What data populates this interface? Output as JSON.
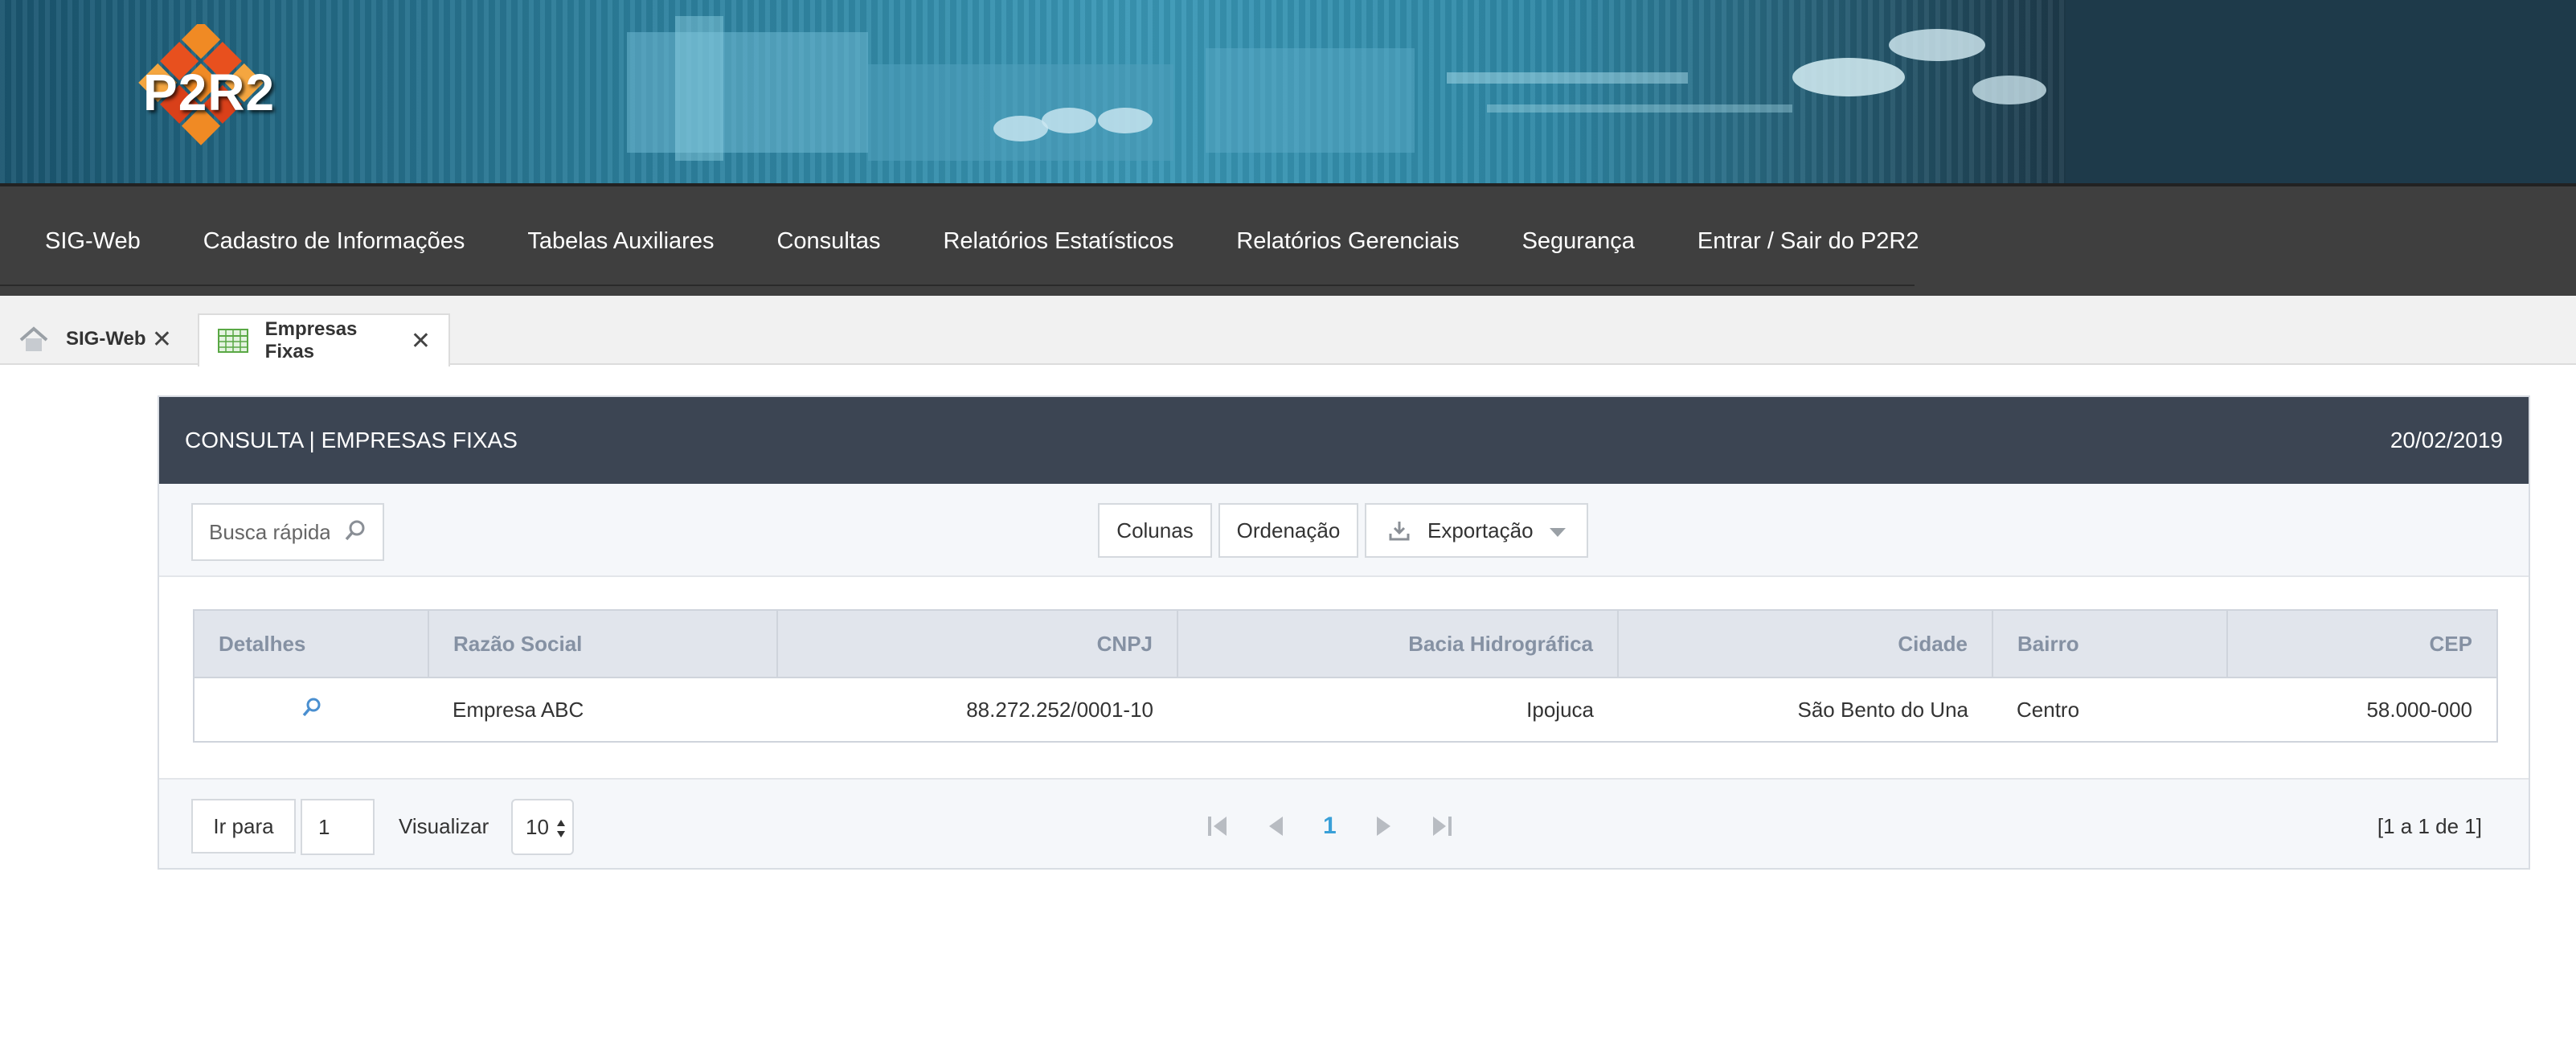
{
  "brand": {
    "logo_text": "P2R2"
  },
  "nav": {
    "items": [
      {
        "label": "SIG-Web"
      },
      {
        "label": "Cadastro de Informações"
      },
      {
        "label": "Tabelas Auxiliares"
      },
      {
        "label": "Consultas"
      },
      {
        "label": "Relatórios Estatísticos"
      },
      {
        "label": "Relatórios Gerenciais"
      },
      {
        "label": "Segurança"
      },
      {
        "label": "Entrar / Sair do P2R2"
      }
    ]
  },
  "tabs": [
    {
      "label": "SIG-Web",
      "icon": "home-icon",
      "close": "✕"
    },
    {
      "label": "Empresas Fixas",
      "icon": "table-icon",
      "close": "✕"
    }
  ],
  "panel": {
    "title": "CONSULTA | EMPRESAS FIXAS",
    "date": "20/02/2019"
  },
  "toolbar": {
    "search_placeholder": "Busca rápida",
    "columns_label": "Colunas",
    "sort_label": "Ordenação",
    "export_label": "Exportação"
  },
  "table": {
    "headers": [
      "Detalhes",
      "Razão Social",
      "CNPJ",
      "Bacia Hidrográfica",
      "Cidade",
      "Bairro",
      "CEP"
    ],
    "rows": [
      {
        "razao_social": "Empresa ABC",
        "cnpj": "88.272.252/0001-10",
        "bacia": "Ipojuca",
        "cidade": "São Bento do Una",
        "bairro": "Centro",
        "cep": "58.000-000"
      }
    ]
  },
  "footer": {
    "goto_label": "Ir para",
    "goto_value": "1",
    "view_label": "Visualizar",
    "page_size": "10",
    "current_page": "1",
    "range_text": "[1 a 1 de 1]"
  },
  "colors": {
    "nav_bg": "#3f3f3f",
    "panel_header_bg": "#3c4553",
    "accent_page": "#3aa0d8",
    "table_header_text": "#8591a3"
  }
}
